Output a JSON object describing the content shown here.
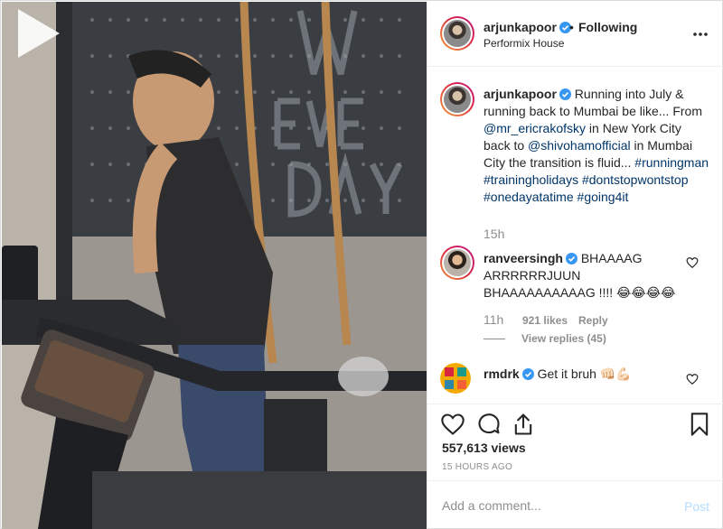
{
  "post": {
    "author": "arjunkapoor",
    "follow_dot": "•",
    "follow_label": "Following",
    "location": "Performix House",
    "more_icon": "more-horizontal-icon"
  },
  "caption": {
    "username": "arjunkapoor",
    "text_1": "Running into July & running back to Mumbai be like... From ",
    "mention_1": "@mr_ericrakofsky",
    "text_2": " in New York City back to ",
    "mention_2": "@shivohamofficial",
    "text_3": " in Mumbai City the transition is fluid... ",
    "hashtags": [
      "#runningman",
      "#trainingholidays",
      "#dontstopwontstop",
      "#onedayatatime",
      "#going4it"
    ],
    "time": "15h"
  },
  "comments": [
    {
      "username": "ranveersingh",
      "text": "BHAAAAG ARRRRRRJUUN BHAAAAAAAAAAG !!!! 😂😂😂😂",
      "time": "11h",
      "likes": "921 likes",
      "reply_label": "Reply",
      "view_replies": "View replies (45)"
    },
    {
      "username": "rmdrk",
      "text": "Get it bruh 👊🏻💪🏻"
    }
  ],
  "stats": {
    "views": "557,613 views",
    "ago": "15 HOURS AGO"
  },
  "composer": {
    "placeholder": "Add a comment...",
    "post_label": "Post"
  },
  "colors": {
    "link": "#003569",
    "muted": "#8e8e8e",
    "verified": "#3897f0",
    "post_disabled": "#b3dbff"
  }
}
